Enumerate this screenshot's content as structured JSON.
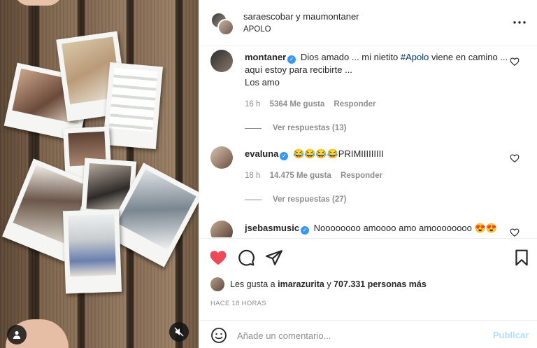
{
  "header": {
    "user1": "saraescobar",
    "connector": "y",
    "user2": "maumontaner",
    "subtitle": "APOLO",
    "more_icon": "more-horizontal-icon"
  },
  "comments": [
    {
      "user": "montaner",
      "verified": true,
      "text_before": " Dios amado ... mi nietito ",
      "hashtag": "#Apolo",
      "text_after": " viene en camino ... aquí estoy para recibirte ...",
      "line2": "Los amo",
      "time": "16 h",
      "likes": "5364 Me gusta",
      "reply": "Responder",
      "view_replies": "Ver respuestas (13)"
    },
    {
      "user": "evaluna",
      "verified": true,
      "text": " 😂😂😂😂PRIMIIIIIIIII",
      "time": "18 h",
      "likes": "14.475 Me gusta",
      "reply": "Responder",
      "view_replies": "Ver respuestas (27)"
    },
    {
      "user": "jsebasmusic",
      "verified": true,
      "text": " Noooooooo amoooo amo amoooooooo 😍😍"
    }
  ],
  "actions": {
    "like_icon": "heart-filled-icon",
    "comment_icon": "comment-icon",
    "share_icon": "share-icon",
    "save_icon": "bookmark-icon",
    "like_color": "#ed4956"
  },
  "likes": {
    "prefix": "Les gusta a ",
    "user": "imarazurita",
    "middle": " y ",
    "count": "707.331 personas más"
  },
  "timestamp": "HACE 18 HORAS",
  "add_comment": {
    "placeholder": "Añade un comentario...",
    "post_label": "Publicar",
    "emoji_icon": "emoji-icon"
  },
  "photo": {
    "user_tag_icon": "user-tag-icon",
    "mute_icon": "speaker-muted-icon"
  }
}
